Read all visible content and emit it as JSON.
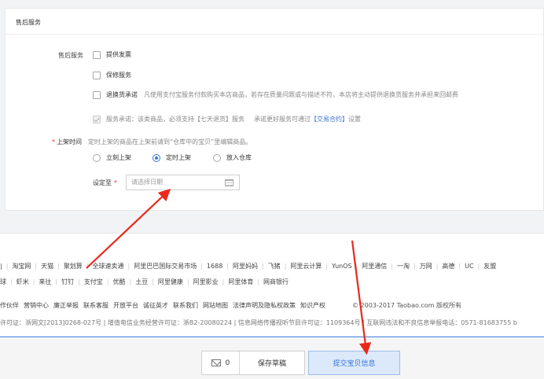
{
  "after_sales": {
    "section_title": "售后服务",
    "field_label": "售后服务",
    "options": [
      {
        "label": "提供发票"
      },
      {
        "label": "保修服务"
      },
      {
        "label": "退换货承诺",
        "desc": "凡使用支付宝服务付款购买本店商品，若存在质量问题或与描述不符，本店将主动提供退换货服务并承担来回邮费"
      }
    ],
    "service_promise": {
      "label": "服务承诺：该类商品，必须支持【七天退货】服务",
      "hint_prefix": "承诺更好服务可通过",
      "hint_link": "【交易合约】",
      "hint_suffix": "设置"
    }
  },
  "listing_time": {
    "required_mark": "*",
    "label": "上架时间",
    "hint": "定时上架的商品在上架前请到“仓库中的宝贝”里编辑商品。",
    "radio_options": [
      "立刻上架",
      "定时上架",
      "放入仓库"
    ],
    "selected": "定时上架",
    "date_label": "设定至",
    "date_placeholder": "请选择日期"
  },
  "footer": {
    "row1": [
      "淘宝网",
      "天猫",
      "聚划算",
      "全球速卖通",
      "阿里巴巴国际交易市场",
      "1688",
      "阿里妈妈",
      "飞猪",
      "阿里云计算",
      "YunOS",
      "阿里通信",
      "一淘",
      "万网",
      "高德",
      "UC",
      "友盟"
    ],
    "row1_lead": "|",
    "row2": [
      "虾米",
      "来往",
      "钉钉",
      "支付宝",
      "优酷",
      "土豆",
      "阿里健康",
      "阿里影业",
      "阿里体育",
      "网商银行"
    ],
    "row2_lead": "球",
    "row3": [
      "作伙伴",
      "营销中心",
      "廉正举报",
      "联系客服",
      "开放平台",
      "诚征英才",
      "联系我们",
      "网站地图",
      "法律声明及隐私权政策",
      "知识产权"
    ],
    "copyright": "© 2003-2017 Taobao.com 版权所有",
    "row4": "许可证：浙网文[2013]0268-027号  |  增值电信业务经营许可证：浙B2-20080224  |  信息网络传播视听节目许可证：1109364号  |  互联网违法和不良信息举报电话：0571-81683755 b"
  },
  "bottom": {
    "message_count": "0",
    "save_draft": "保存草稿",
    "submit": "提交宝贝信息"
  },
  "annotation_color": "#e8291c",
  "accent_color": "#3a74d8"
}
